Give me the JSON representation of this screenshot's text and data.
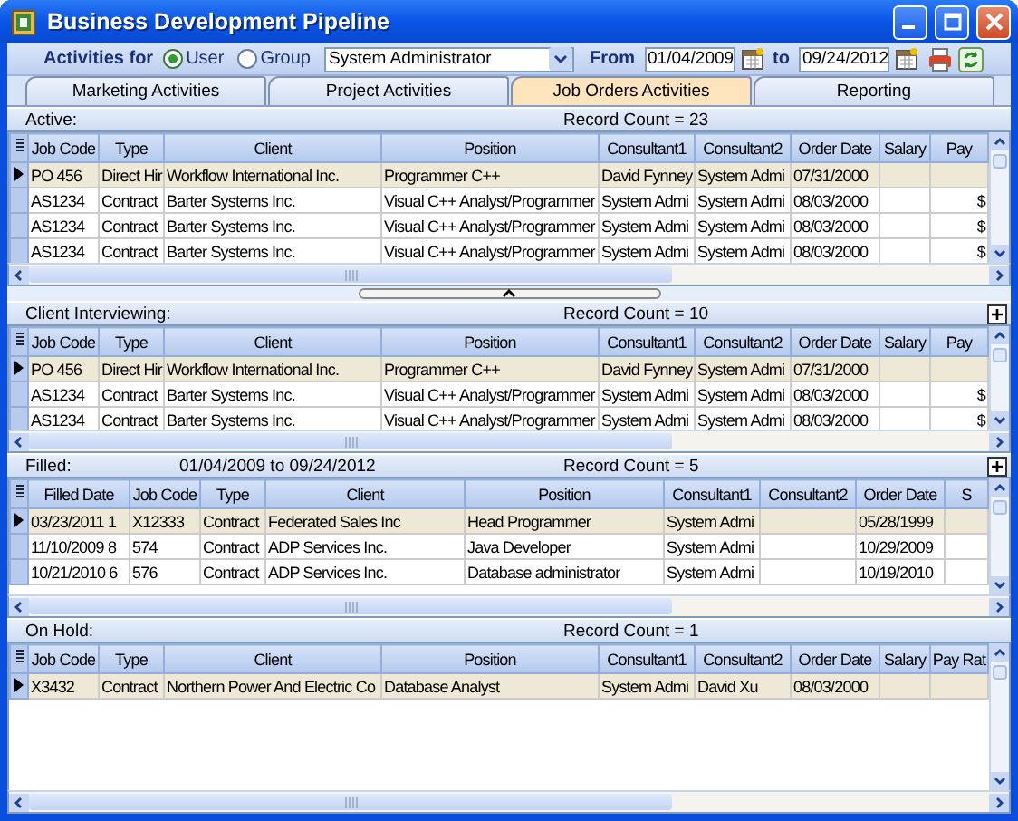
{
  "window": {
    "title": "Business Development Pipeline"
  },
  "toolbar": {
    "activities_label": "Activities for",
    "scope_options": [
      {
        "label": "User",
        "selected": true
      },
      {
        "label": "Group",
        "selected": false
      }
    ],
    "person": "System Administrator",
    "from_label": "From",
    "from_date": "01/04/2009",
    "to_label": "to",
    "to_date": "09/24/2012"
  },
  "tabs": [
    {
      "label": "Marketing Activities",
      "selected": false
    },
    {
      "label": "Project Activities",
      "selected": false
    },
    {
      "label": "Job Orders Activities",
      "selected": true
    },
    {
      "label": "Reporting",
      "selected": false
    }
  ],
  "sections": [
    {
      "title": "Active:",
      "record_count": "Record Count = 23",
      "expand_button": false,
      "splitter_after": true,
      "columns": [
        {
          "label": "Job Code",
          "kind": "code"
        },
        {
          "label": "Type",
          "kind": "type"
        },
        {
          "label": "Client",
          "kind": "client"
        },
        {
          "label": "Position",
          "kind": "position"
        },
        {
          "label": "Consultant1",
          "kind": "person"
        },
        {
          "label": "Consultant2",
          "kind": "person"
        },
        {
          "label": "Order Date",
          "kind": "date"
        },
        {
          "label": "Salary",
          "kind": "money"
        },
        {
          "label": "Pay",
          "kind": "money"
        }
      ],
      "rows": [
        {
          "selected": true,
          "cells": [
            "PO 456",
            "Direct Hir",
            "Workflow International Inc.",
            "Programmer C++",
            "David Fynney",
            "System Admi",
            "07/31/2000",
            "",
            ""
          ]
        },
        {
          "selected": false,
          "cells": [
            "AS1234",
            "Contract",
            "Barter Systems Inc.",
            "Visual C++ Analyst/Programmer",
            "System Admi",
            "System Admi",
            "08/03/2000",
            "",
            "$"
          ]
        },
        {
          "selected": false,
          "cells": [
            "AS1234",
            "Contract",
            "Barter Systems Inc.",
            "Visual C++ Analyst/Programmer",
            "System Admi",
            "System Admi",
            "08/03/2000",
            "",
            "$"
          ]
        },
        {
          "selected": false,
          "cells": [
            "AS1234",
            "Contract",
            "Barter Systems Inc.",
            "Visual C++ Analyst/Programmer",
            "System Admi",
            "System Admi",
            "08/03/2000",
            "",
            "$"
          ]
        }
      ]
    },
    {
      "title": "Client Interviewing:",
      "record_count": "Record Count = 10",
      "expand_button": true,
      "columns": [
        {
          "label": "Job Code",
          "kind": "code"
        },
        {
          "label": "Type",
          "kind": "type"
        },
        {
          "label": "Client",
          "kind": "client"
        },
        {
          "label": "Position",
          "kind": "position"
        },
        {
          "label": "Consultant1",
          "kind": "person"
        },
        {
          "label": "Consultant2",
          "kind": "person"
        },
        {
          "label": "Order Date",
          "kind": "date"
        },
        {
          "label": "Salary",
          "kind": "money"
        },
        {
          "label": "Pay",
          "kind": "money"
        }
      ],
      "rows": [
        {
          "selected": true,
          "cells": [
            "PO 456",
            "Direct Hir",
            "Workflow International Inc.",
            "Programmer C++",
            "David Fynney",
            "System Admi",
            "07/31/2000",
            "",
            ""
          ]
        },
        {
          "selected": false,
          "cells": [
            "AS1234",
            "Contract",
            "Barter Systems Inc.",
            "Visual C++ Analyst/Programmer",
            "System Admi",
            "System Admi",
            "08/03/2000",
            "",
            "$"
          ]
        },
        {
          "selected": false,
          "cells": [
            "AS1234",
            "Contract",
            "Barter Systems Inc.",
            "Visual C++ Analyst/Programmer",
            "System Admi",
            "System Admi",
            "08/03/2000",
            "",
            "$"
          ]
        }
      ]
    },
    {
      "title": "Filled:",
      "date_range": "01/04/2009 to 09/24/2012",
      "record_count": "Record Count = 5",
      "expand_button": true,
      "columns": [
        {
          "label": "Filled Date",
          "kind": "datetime"
        },
        {
          "label": "Job Code",
          "kind": "code"
        },
        {
          "label": "Type",
          "kind": "type"
        },
        {
          "label": "Client",
          "kind": "client"
        },
        {
          "label": "Position",
          "kind": "position"
        },
        {
          "label": "Consultant1",
          "kind": "person"
        },
        {
          "label": "Consultant2",
          "kind": "person"
        },
        {
          "label": "Order Date",
          "kind": "date"
        },
        {
          "label": "S",
          "kind": "money"
        }
      ],
      "rows": [
        {
          "selected": true,
          "cells": [
            "03/23/2011 1",
            "X12333",
            "Contract",
            "Federated Sales Inc",
            "Head Programmer",
            "System Admi",
            "",
            "05/28/1999",
            ""
          ]
        },
        {
          "selected": false,
          "cells": [
            "11/10/2009 8",
            "574",
            "Contract",
            "ADP Services Inc.",
            "Java Developer",
            "System Admi",
            "",
            "10/29/2009",
            ""
          ]
        },
        {
          "selected": false,
          "cells": [
            "10/21/2010 6",
            "576",
            "Contract",
            "ADP Services Inc.",
            "Database administrator",
            "System Admi",
            "",
            "10/19/2010",
            ""
          ]
        }
      ]
    },
    {
      "title": "On Hold:",
      "record_count": "Record Count = 1",
      "expand_button": false,
      "columns": [
        {
          "label": "Job Code",
          "kind": "code"
        },
        {
          "label": "Type",
          "kind": "type"
        },
        {
          "label": "Client",
          "kind": "client"
        },
        {
          "label": "Position",
          "kind": "position"
        },
        {
          "label": "Consultant1",
          "kind": "person"
        },
        {
          "label": "Consultant2",
          "kind": "person"
        },
        {
          "label": "Order Date",
          "kind": "date"
        },
        {
          "label": "Salary",
          "kind": "money"
        },
        {
          "label": "Pay Rat",
          "kind": "money"
        }
      ],
      "rows": [
        {
          "selected": true,
          "cells": [
            "X3432",
            "Contract",
            "Northern Power And Electric Co",
            "Database Analyst",
            "System Admi",
            "David Xu",
            "08/03/2000",
            "",
            ""
          ]
        }
      ]
    }
  ]
}
